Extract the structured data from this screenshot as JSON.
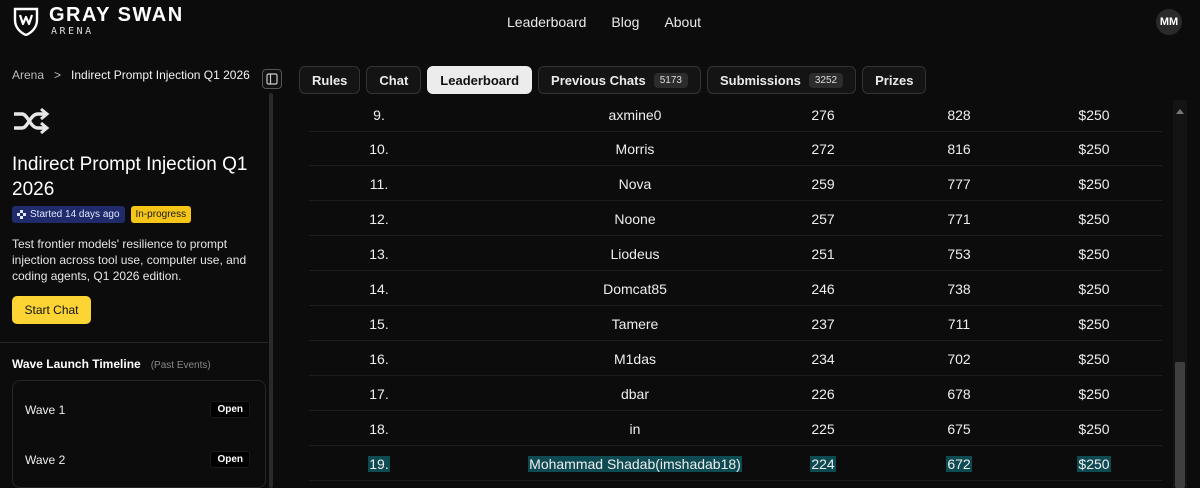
{
  "header": {
    "logo_title": "GRAY SWAN",
    "logo_subtitle": "ARENA",
    "nav": [
      "Leaderboard",
      "Blog",
      "About"
    ],
    "avatar_initials": "MM"
  },
  "breadcrumb": {
    "root": "Arena",
    "separator": ">",
    "current": "Indirect Prompt Injection Q1 2026"
  },
  "challenge": {
    "icon": "shuffle-icon",
    "title": "Indirect Prompt Injection Q1 2026",
    "started_badge": "Started 14 days ago",
    "status_badge": "In-progress",
    "description": "Test frontier models' resilience to prompt injection across tool use, computer use, and coding agents, Q1 2026 edition.",
    "start_button": "Start Chat"
  },
  "timeline": {
    "title": "Wave Launch Timeline",
    "subtitle": "(Past Events)",
    "waves": [
      {
        "name": "Wave 1",
        "status": "Open"
      },
      {
        "name": "Wave 2",
        "status": "Open"
      }
    ]
  },
  "tabs": [
    {
      "label": "Rules",
      "count": null,
      "active": false
    },
    {
      "label": "Chat",
      "count": null,
      "active": false
    },
    {
      "label": "Leaderboard",
      "count": null,
      "active": true
    },
    {
      "label": "Previous Chats",
      "count": "5173",
      "active": false
    },
    {
      "label": "Submissions",
      "count": "3252",
      "active": false
    },
    {
      "label": "Prizes",
      "count": null,
      "active": false
    }
  ],
  "leaderboard": {
    "rows": [
      {
        "rank": "9.",
        "name": "axmine0",
        "score": "276",
        "points": "828",
        "prize": "$250",
        "highlight": false
      },
      {
        "rank": "10.",
        "name": "Morris",
        "score": "272",
        "points": "816",
        "prize": "$250",
        "highlight": false
      },
      {
        "rank": "11.",
        "name": "Nova",
        "score": "259",
        "points": "777",
        "prize": "$250",
        "highlight": false
      },
      {
        "rank": "12.",
        "name": "Noone",
        "score": "257",
        "points": "771",
        "prize": "$250",
        "highlight": false
      },
      {
        "rank": "13.",
        "name": "Liodeus",
        "score": "251",
        "points": "753",
        "prize": "$250",
        "highlight": false
      },
      {
        "rank": "14.",
        "name": "Domcat85",
        "score": "246",
        "points": "738",
        "prize": "$250",
        "highlight": false
      },
      {
        "rank": "15.",
        "name": "Tamere",
        "score": "237",
        "points": "711",
        "prize": "$250",
        "highlight": false
      },
      {
        "rank": "16.",
        "name": "M1das",
        "score": "234",
        "points": "702",
        "prize": "$250",
        "highlight": false
      },
      {
        "rank": "17.",
        "name": "dbar",
        "score": "226",
        "points": "678",
        "prize": "$250",
        "highlight": false
      },
      {
        "rank": "18.",
        "name": "in",
        "score": "225",
        "points": "675",
        "prize": "$250",
        "highlight": false
      },
      {
        "rank": "19.",
        "name": "Mohammad Shadab(imshadab18)",
        "score": "224",
        "points": "672",
        "prize": "$250",
        "highlight": true
      }
    ]
  },
  "colors": {
    "background": "#0c0c0c",
    "accent_yellow": "#fcd535",
    "highlight": "#0e4a52",
    "started_badge": "#1f2b6b"
  }
}
